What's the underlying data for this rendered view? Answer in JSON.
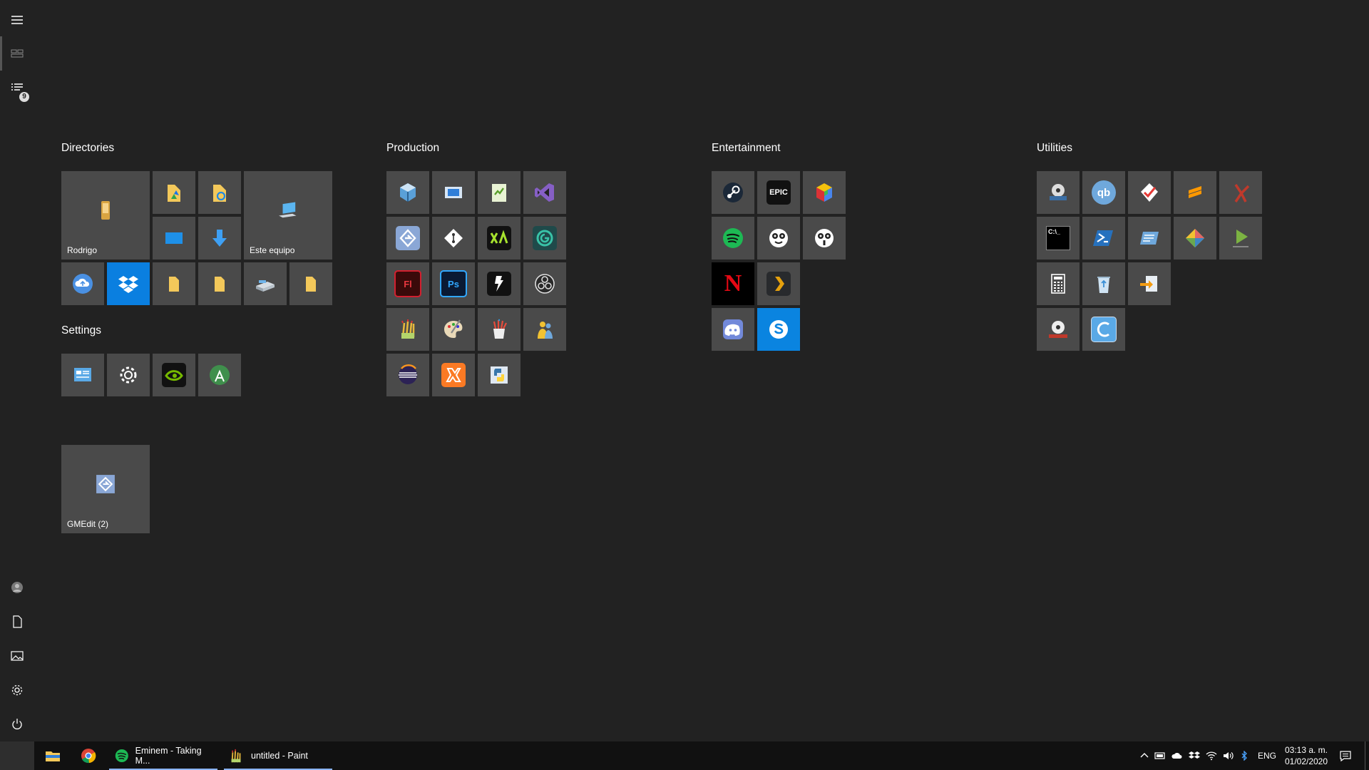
{
  "rail": {
    "items": [
      "menu-icon",
      "all-apps-icon",
      "recent-list-icon",
      "avatar",
      "document-icon",
      "pictures-icon",
      "settings-icon",
      "power-icon"
    ],
    "badge_count": "9"
  },
  "groups": {
    "directories": {
      "title": "Directories",
      "rodrigo_label": "Rodrigo",
      "este_equipo_label": "Este equipo"
    },
    "settings": {
      "title": "Settings"
    },
    "production": {
      "title": "Production"
    },
    "entertainment": {
      "title": "Entertainment"
    },
    "utilities": {
      "title": "Utilities"
    },
    "misc": {
      "gmedit_label": "GMEdit (2)"
    }
  },
  "icon_text": {
    "epic": "EPIC",
    "flash": "Fl",
    "photoshop": "Ps",
    "qbittorrent": "qb",
    "netflix": "N",
    "cmd": "C:\\_"
  },
  "taskbar": {
    "items": [
      {
        "label": "Eminem - Taking M...",
        "icon": "spotify-icon"
      },
      {
        "label": "untitled - Paint",
        "icon": "paint-icon"
      }
    ],
    "language": "ENG",
    "time": "03:13 a. m.",
    "date": "01/02/2020"
  },
  "colors": {
    "background": "#222222",
    "tile": "#4a4a4a",
    "taskbar": "#111111",
    "dropbox": "#0a7fe0",
    "skype": "#0a84e0",
    "netflix": "#e50914",
    "spotify": "#1db954"
  }
}
